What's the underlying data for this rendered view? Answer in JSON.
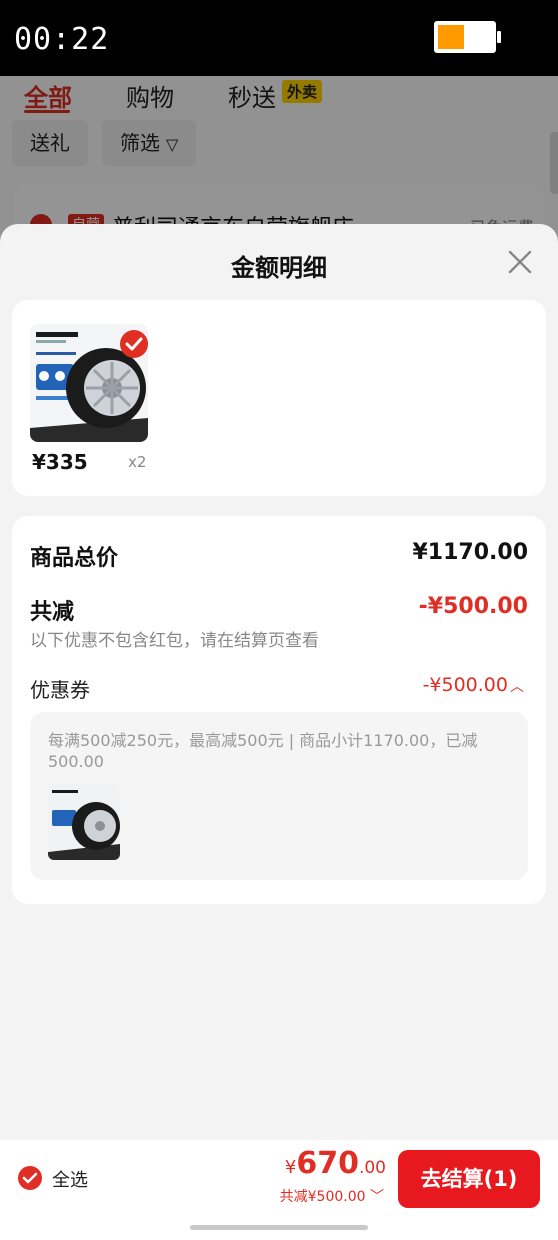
{
  "status_bar": {
    "time": "00:22",
    "battery_level": 0.45,
    "battery_color": "#ff9a00"
  },
  "background_page": {
    "tabs": [
      {
        "label": "全部",
        "active": true
      },
      {
        "label": "购物",
        "active": false
      },
      {
        "label": "秒送",
        "active": false,
        "badge": "外卖"
      }
    ],
    "chips": [
      {
        "label": "送礼"
      },
      {
        "label": "筛选",
        "icon": "filter-icon"
      }
    ],
    "shop_line": {
      "tag": "自营",
      "name": "普利司通京东自营旗舰店",
      "shipping": "已免运费"
    }
  },
  "sheet": {
    "title": "金额明细",
    "product": {
      "image": "bridgestone-tire",
      "price": "¥335",
      "qty": "x2",
      "selected": true
    },
    "summary": {
      "total_label": "商品总价",
      "total_value": "¥1170.00",
      "reduced_label": "共减",
      "reduced_value": "-¥500.00",
      "note": "以下优惠不包含红包，请在结算页查看",
      "coupon_label": "优惠券",
      "coupon_value": "-¥500.00",
      "coupon_desc": "每满500减250元，最高减500元 | 商品小计1170.00，已减500.00"
    }
  },
  "bottom_bar": {
    "select_all": "全选",
    "currency": "¥",
    "total_int": "670",
    "total_dec": ".00",
    "discount_text": "共减¥500.00",
    "checkout_label": "去结算(1)"
  },
  "colors": {
    "accent": "#e02e24",
    "checkout_bg": "#e8191e",
    "waimai_badge": "#ffd400"
  }
}
